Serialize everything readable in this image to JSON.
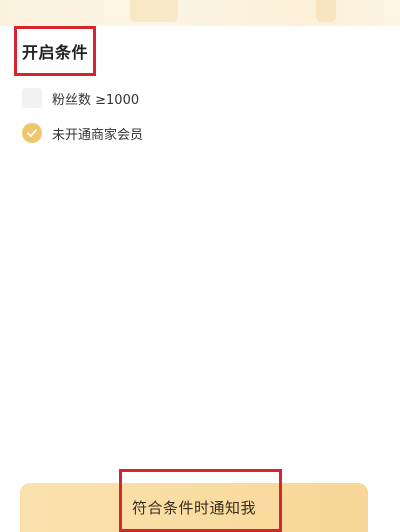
{
  "section": {
    "title": "开启条件"
  },
  "conditions": [
    {
      "label": "粉丝数 ≥1000",
      "checked": false
    },
    {
      "label": "未开通商家会员",
      "checked": true
    }
  ],
  "action": {
    "notify_label": "符合条件时通知我"
  },
  "colors": {
    "accent": "#f1c56d",
    "button_bg": "#f8d797",
    "highlight_border": "#d4262b"
  }
}
